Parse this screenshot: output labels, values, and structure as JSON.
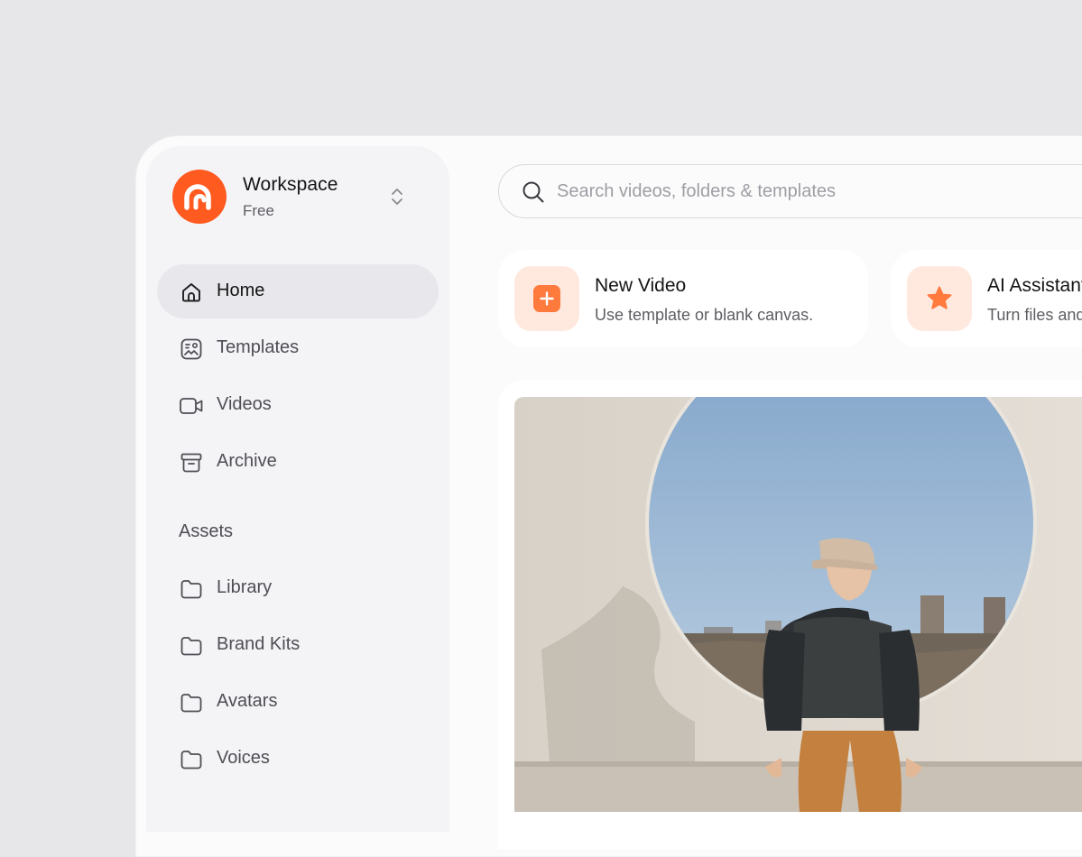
{
  "workspace": {
    "name": "Workspace",
    "plan": "Free"
  },
  "nav": [
    {
      "label": "Home",
      "icon": "home-icon",
      "active": true
    },
    {
      "label": "Templates",
      "icon": "templates-icon"
    },
    {
      "label": "Videos",
      "icon": "video-camera-icon"
    },
    {
      "label": "Archive",
      "icon": "archive-box-icon"
    }
  ],
  "assets": {
    "heading": "Assets",
    "items": [
      {
        "label": "Library",
        "icon": "folder-icon"
      },
      {
        "label": "Brand Kits",
        "icon": "folder-icon"
      },
      {
        "label": "Avatars",
        "icon": "folder-icon"
      },
      {
        "label": "Voices",
        "icon": "folder-icon"
      }
    ]
  },
  "search": {
    "placeholder": "Search videos, folders & templates"
  },
  "quick_actions": [
    {
      "title": "New Video",
      "description": "Use template or blank canvas.",
      "icon": "plus-square-icon"
    },
    {
      "title": "AI Assistant",
      "description": "Turn files and",
      "icon": "star-icon"
    }
  ],
  "preview": {
    "icon": "photo-preview"
  },
  "colors": {
    "accent": "#ff5a1f",
    "accent_soft": "#ffe9df",
    "sidebar_bg": "#f4f3f6",
    "active_item_bg": "#e8e7eb",
    "page_bg": "#e7e6e8"
  }
}
